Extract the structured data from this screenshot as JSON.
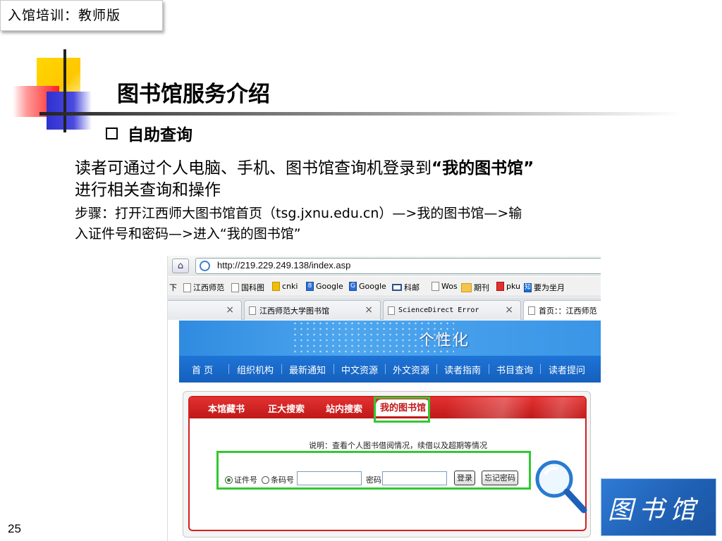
{
  "slide": {
    "tag": "入馆培训：教师版",
    "title": "图书馆服务介绍",
    "bullet": "自助查询",
    "para1_before": "读者可通过个人电脑、手机、图书馆查询机登录到",
    "para1_bold": "“我的图书馆”",
    "para1_after": "进行相关查询和操作",
    "para2_line1": "步骤：打开江西师大图书馆首页（tsg.jxnu.edu.cn）—>我的图书馆—>输",
    "para2_line2": "入证件号和密码—>进入“我的图书馆”",
    "page_number": "25",
    "logo_text": "图书馆"
  },
  "browser": {
    "address": "http://219.229.249.138/index.asp",
    "bookmarks": [
      {
        "label": "下",
        "icon": "none"
      },
      {
        "label": "江西师范",
        "icon": "page-icon"
      },
      {
        "label": "国科图",
        "icon": "page-icon"
      },
      {
        "label": "cnki",
        "icon": "cnki-icon"
      },
      {
        "label": "Google",
        "icon": "google-icon"
      },
      {
        "label": "Google",
        "icon": "google-icon"
      },
      {
        "label": "科邮",
        "icon": "mail-icon"
      },
      {
        "label": "Wos",
        "icon": "page-icon"
      },
      {
        "label": "期刊",
        "icon": "folder-icon"
      },
      {
        "label": "pku",
        "icon": "pku-icon"
      },
      {
        "label": "要为坐月",
        "icon": "zhihu-icon"
      }
    ],
    "tabs": [
      {
        "label": "",
        "close": "×"
      },
      {
        "label": "江西师范大学图书馆",
        "close": "×"
      },
      {
        "label": "ScienceDirect Error",
        "close": "×"
      },
      {
        "label": "首页：：江西师范",
        "close": ""
      }
    ]
  },
  "site": {
    "slogan": "个性化",
    "nav": [
      "首 页",
      "组织机构",
      "最新通知",
      "中文资源",
      "外文资源",
      "读者指南",
      "书目查询",
      "读者提问"
    ],
    "panel_tabs": [
      "本馆藏书",
      "正大搜索",
      "站内搜索",
      "我的图书馆"
    ],
    "note": "说明：查看个人图书借阅情况，续借以及超期等情况",
    "radio_card": "证件号",
    "radio_barcode": "条码号",
    "password_label": "密码",
    "login_button": "登录",
    "forgot_button": "忘记密码"
  },
  "colors": {
    "nav_blue": "#1560bd",
    "panel_red": "#c01818",
    "highlight_green": "#32c832"
  }
}
